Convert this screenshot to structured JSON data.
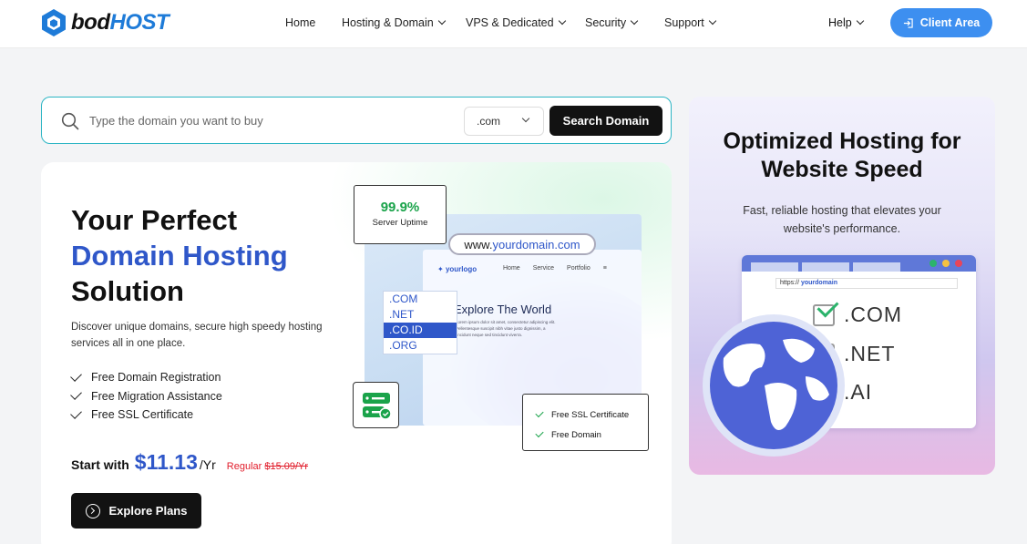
{
  "brand": {
    "logo_part1": "bod",
    "logo_part2": "HOST",
    "accent": "#1e7bd8"
  },
  "nav": {
    "items": [
      {
        "label": "Home",
        "dropdown": false
      },
      {
        "label": "Hosting & Domain",
        "dropdown": true
      },
      {
        "label": "VPS & Dedicated",
        "dropdown": true
      },
      {
        "label": "Security",
        "dropdown": true
      },
      {
        "label": "Support",
        "dropdown": true
      }
    ],
    "help_label": "Help",
    "client_area_label": "Client Area"
  },
  "search": {
    "placeholder": "Type the domain you want to buy",
    "value": "",
    "tld_selected": ".com",
    "button_label": "Search Domain"
  },
  "hero": {
    "title_line1": "Your Perfect",
    "title_accent": "Domain Hosting",
    "title_line3": "Solution",
    "description": "Discover unique domains, secure high speedy hosting services all in one place.",
    "features": [
      "Free Domain Registration",
      "Free Migration Assistance",
      "Free SSL Certificate"
    ],
    "price_prefix": "Start with",
    "price": "$11.13",
    "price_unit": "/Yr",
    "regular_label": "Regular",
    "regular_price": "$15.09/Yr",
    "explore_label": "Explore Plans"
  },
  "illustration": {
    "uptime_value": "99.9%",
    "uptime_label": "Server Uptime",
    "url_prefix": "www.",
    "url_domain": "yourdomain",
    "url_suffix": ".com",
    "mini_logo": "yourlogo",
    "mini_nav": [
      "Home",
      "Service",
      "Portfolio"
    ],
    "mini_heading": "Explore The World",
    "mini_text": "Lorem ipsum dolor sit amet, consectetur adipiscing elit. Pellentesque suscipit nibh vitae justo dignissim, a tincidunt neque sed tincidunt viverra.",
    "tld_options": [
      ".COM",
      ".NET",
      ".CO.ID",
      ".ORG"
    ],
    "tld_selected_index": 2,
    "ssl_items": [
      "Free SSL Certificate",
      "Free Domain"
    ]
  },
  "promo": {
    "title": "Optimized Hosting for Website Speed",
    "subtitle": "Fast, reliable hosting that elevates your website's performance.",
    "address_prefix": "https://",
    "address_domain": "yourdomain",
    "tlds": [
      {
        "label": ".COM",
        "checked": true
      },
      {
        "label": ".NET",
        "checked": false
      },
      {
        "label": ".AI",
        "checked": false
      }
    ]
  }
}
